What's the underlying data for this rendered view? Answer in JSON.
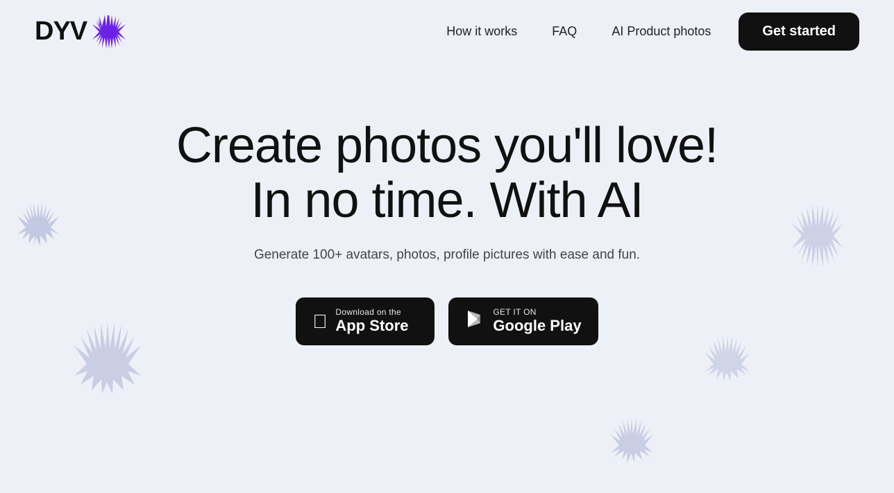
{
  "logo": {
    "text": "DYV",
    "brand_color": "#6B21E8"
  },
  "nav": {
    "links": [
      {
        "label": "How it works",
        "href": "#"
      },
      {
        "label": "FAQ",
        "href": "#"
      },
      {
        "label": "AI Product photos",
        "href": "#"
      }
    ],
    "cta_label": "Get started"
  },
  "hero": {
    "line1": "Create photos you'll love!",
    "line2": "In no time. With AI",
    "description": "Generate 100+ avatars, photos, profile pictures with ease and fun.",
    "app_store": {
      "top": "Download on the",
      "main": "App Store"
    },
    "google_play": {
      "top": "GET IT ON",
      "main": "Google Play"
    }
  },
  "decorations": {
    "accent_color": "#b0b8d8",
    "brand_color": "#6B21E8"
  }
}
